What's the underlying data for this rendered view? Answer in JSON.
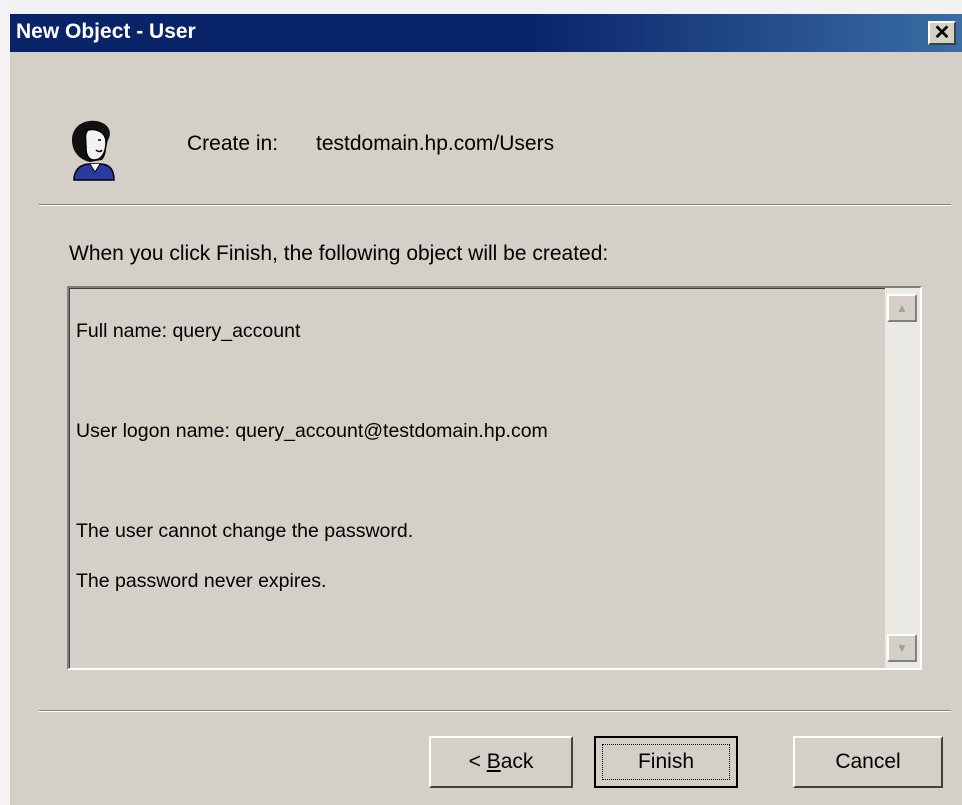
{
  "window": {
    "title": "New Object - User",
    "close_glyph": "✕"
  },
  "header": {
    "icon": "user-icon",
    "create_in_label": "Create in:",
    "create_in_path": "testdomain.hp.com/Users"
  },
  "body": {
    "intro": "When you click Finish, the following object will be created:",
    "summary": {
      "full_name": "Full name: query_account",
      "logon_name": "User logon name: query_account@testdomain.hp.com",
      "password_change": "The user cannot change the password.",
      "password_expiry": "The password never expires."
    },
    "scrollbar": {
      "up_arrow": "▲",
      "down_arrow": "▼"
    }
  },
  "buttons": {
    "back_prefix": "< ",
    "back_accel": "B",
    "back_rest": "ack",
    "finish": "Finish",
    "cancel": "Cancel"
  },
  "colors": {
    "titlebar": "#0a246a",
    "face": "#d4d0c8",
    "icon_shirt": "#2a3aa0"
  }
}
